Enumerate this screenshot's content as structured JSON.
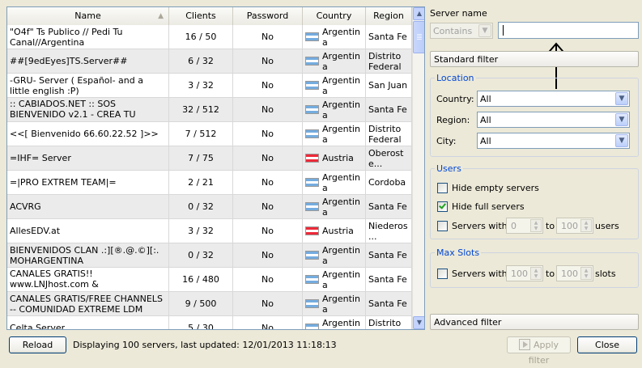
{
  "table": {
    "columns": [
      "Name",
      "Clients",
      "Password",
      "Country",
      "Region"
    ],
    "rows": [
      {
        "name": "\"O4f\" Ts Publico // Pedi Tu Canal//Argentina",
        "clients": "16 / 50",
        "password": "No",
        "country": "Argentina",
        "flag": "ar",
        "region": "Santa Fe"
      },
      {
        "name": "##[9edEyes]TS.Server##",
        "clients": "6 / 32",
        "password": "No",
        "country": "Argentina",
        "flag": "ar",
        "region": "Distrito Federal"
      },
      {
        "name": "-GRU- Server ( Español- and a little english :P)",
        "clients": "3 / 32",
        "password": "No",
        "country": "Argentina",
        "flag": "ar",
        "region": "San Juan"
      },
      {
        "name": ":: CABIADOS.NET :: SOS BIENVENIDO v2.1 - CREA TU CANAL",
        "clients": "32 / 512",
        "password": "No",
        "country": "Argentina",
        "flag": "ar",
        "region": "Santa Fe"
      },
      {
        "name": "<<[ Bienvenido 66.60.22.52 ]>>",
        "clients": "7 / 512",
        "password": "No",
        "country": "Argentina",
        "flag": "ar",
        "region": "Distrito Federal"
      },
      {
        "name": "=IHF= Server",
        "clients": "7 / 75",
        "password": "No",
        "country": "Austria",
        "flag": "at",
        "region": "Oberoste..."
      },
      {
        "name": "=|PRO EXTREM TEAM|=",
        "clients": "2 / 21",
        "password": "No",
        "country": "Argentina",
        "flag": "ar",
        "region": "Cordoba"
      },
      {
        "name": "ACVRG",
        "clients": "0 / 32",
        "password": "No",
        "country": "Argentina",
        "flag": "ar",
        "region": "Santa Fe"
      },
      {
        "name": "AllesEDV.at",
        "clients": "3 / 32",
        "password": "No",
        "country": "Austria",
        "flag": "at",
        "region": "Niederos..."
      },
      {
        "name": "BIENVENIDOS CLAN .:][®.@.©][:. MOHARGENTINA",
        "clients": "0 / 32",
        "password": "No",
        "country": "Argentina",
        "flag": "ar",
        "region": "Santa Fe"
      },
      {
        "name": "CANALES GRATIS!! www.LNJhost.com & www.ImperioLN...",
        "clients": "16 / 480",
        "password": "No",
        "country": "Argentina",
        "flag": "ar",
        "region": "Santa Fe"
      },
      {
        "name": "CANALES GRATIS/FREE CHANNELS -- COMUNIDAD EXTREME LDM",
        "clients": "9 / 500",
        "password": "No",
        "country": "Argentina",
        "flag": "ar",
        "region": "Santa Fe"
      },
      {
        "name": "Celta Server",
        "clients": "5 / 30",
        "password": "No",
        "country": "Argentina",
        "flag": "ar",
        "region": "Distrito Federal"
      }
    ]
  },
  "filter": {
    "server_name_label": "Server name",
    "match_mode": "Contains",
    "name_value": "",
    "standard_filter": "Standard filter",
    "location": {
      "title": "Location",
      "country_label": "Country:",
      "country_value": "All",
      "region_label": "Region:",
      "region_value": "All",
      "city_label": "City:",
      "city_value": "All"
    },
    "users": {
      "title": "Users",
      "hide_empty": "Hide empty servers",
      "hide_full": "Hide full servers",
      "servers_with": "Servers with",
      "from": "0",
      "to_label": "to",
      "to": "100",
      "unit": "users"
    },
    "max_slots": {
      "title": "Max Slots",
      "servers_with": "Servers with",
      "from": "100",
      "to_label": "to",
      "to": "100",
      "unit": "slots"
    },
    "advanced_filter": "Advanced filter"
  },
  "bottom": {
    "reload": "Reload",
    "status": "Displaying 100 servers, last updated: 12/01/2013 11:18:13",
    "apply": "Apply filter",
    "close": "Close"
  }
}
